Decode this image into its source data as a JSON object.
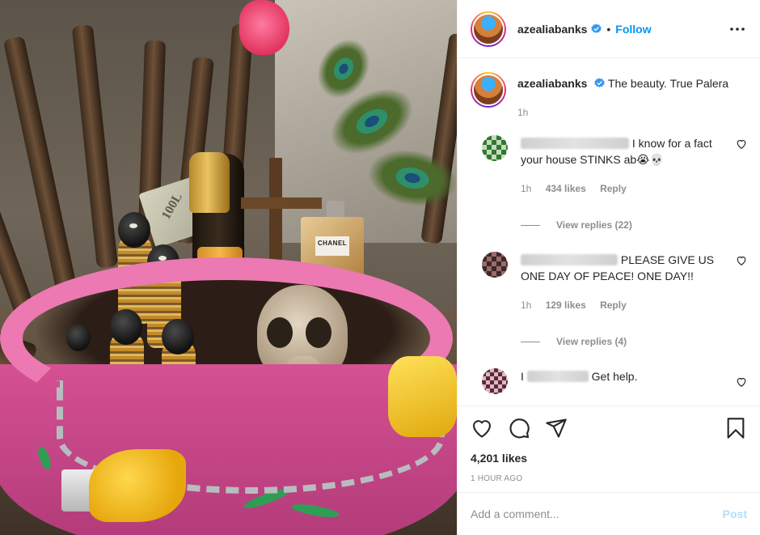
{
  "post": {
    "author": "azealiabanks",
    "verified": true,
    "follow_label": "Follow",
    "dot": "•",
    "caption": "The beauty. True Palera",
    "caption_time": "1h",
    "likes": "4,201 likes",
    "timestamp": "1 hour ago",
    "image": {
      "bill_text": "100L",
      "perfume_text": "CHANEL"
    }
  },
  "comments": [
    {
      "text": "I know for a fact your house STINKS ab😭💀",
      "time": "1h",
      "likes": "434 likes",
      "reply": "Reply",
      "view_replies": "View replies (22)"
    },
    {
      "text": "PLEASE GIVE US ONE DAY OF PEACE! ONE DAY!!",
      "time": "1h",
      "likes": "129 likes",
      "reply": "Reply",
      "view_replies": "View replies (4)"
    },
    {
      "text_prefix": "I",
      "text": "Get help."
    }
  ],
  "composer": {
    "placeholder": "Add a comment...",
    "post_label": "Post"
  },
  "colors": {
    "accent": "#0095f6",
    "post_disabled": "#b2dffc",
    "muted": "#8e8e8e",
    "text": "#262626"
  },
  "icons": [
    "verified-icon",
    "more-options-icon",
    "heart-icon",
    "comment-icon",
    "share-icon",
    "bookmark-icon"
  ]
}
